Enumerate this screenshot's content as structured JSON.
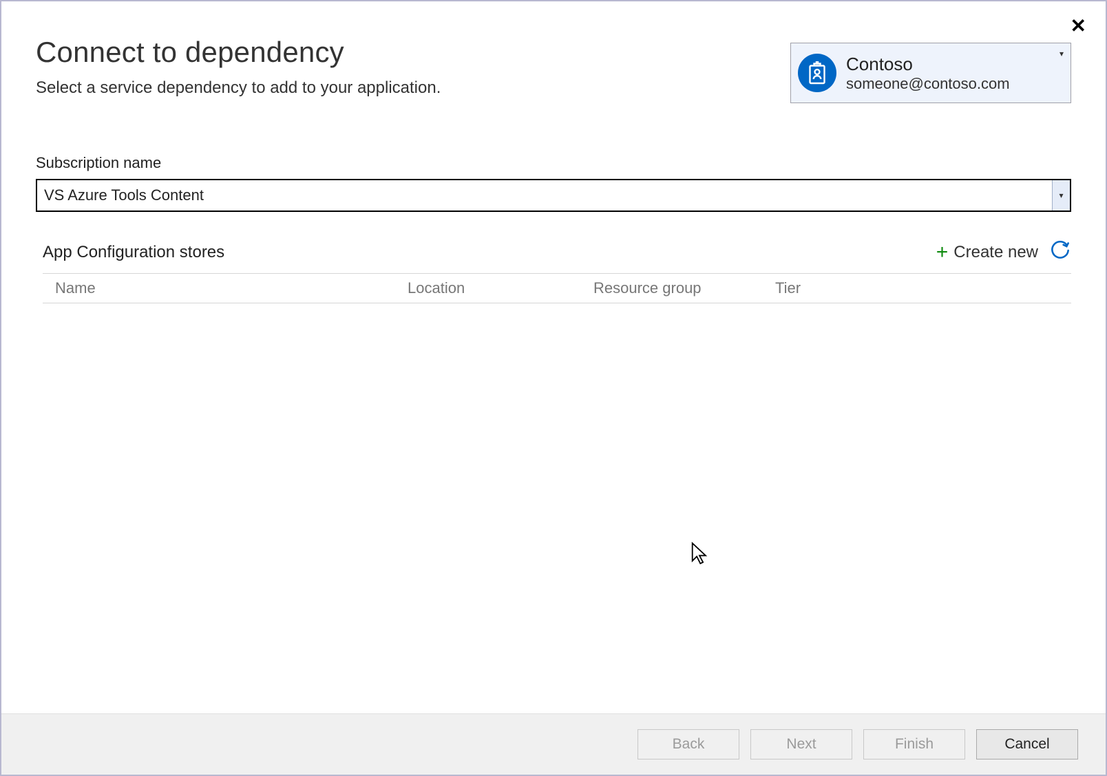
{
  "header": {
    "title": "Connect to dependency",
    "subtitle": "Select a service dependency to add to your application."
  },
  "account": {
    "name": "Contoso",
    "email": "someone@contoso.com"
  },
  "subscription": {
    "label": "Subscription name",
    "value": "VS Azure Tools Content"
  },
  "table": {
    "title": "App Configuration stores",
    "create_label": "Create new",
    "columns": {
      "name": "Name",
      "location": "Location",
      "resource_group": "Resource group",
      "tier": "Tier"
    }
  },
  "wizard": {
    "back": "Back",
    "next": "Next",
    "finish": "Finish",
    "cancel": "Cancel"
  }
}
